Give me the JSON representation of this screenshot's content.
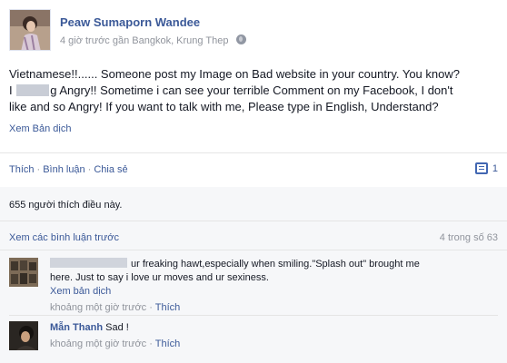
{
  "post": {
    "author": "Peaw Sumaporn Wandee",
    "meta": "4 giờ trước gần Bangkok, Krung Thep",
    "line1": "Vietnamese!!...... Someone post my Image on Bad website in your country. You know?",
    "line2_before": "I ",
    "line2_after": "g Angry!! Sometime i can see your terrible Comment on my Facebook, I don't",
    "line3": "like and so Angry! If you want to talk with me, Please type in English, Understand?",
    "translate": "Xem Bản dịch",
    "privacy_icon": "globe-icon"
  },
  "actions": {
    "like": "Thích",
    "comment": "Bình luận",
    "share": "Chia sẻ",
    "separator": "·",
    "comment_count": "1",
    "comment_icon": "comment-icon"
  },
  "ufi": {
    "likes_text": "655 người thích điều này.",
    "view_previous": "Xem các bình luận trước",
    "view_count": "4 trong số 63"
  },
  "comments": [
    {
      "name": "",
      "text_line1": "ur freaking hawt,especially when smiling.\"Splash out\" brought me",
      "text_line2": "here. Just to say i love ur moves and ur sexiness.",
      "translate": "Xem bản dịch",
      "time": "khoảng một giờ trước",
      "separator": "·",
      "like": "Thích"
    },
    {
      "name": "Mẫn Thanh",
      "text": "Sad !",
      "time": "khoảng một giờ trước",
      "separator": "·",
      "like": "Thích"
    }
  ],
  "colors": {
    "link": "#3b5998",
    "muted": "#90949c",
    "comments_bg": "#f6f7f9"
  }
}
